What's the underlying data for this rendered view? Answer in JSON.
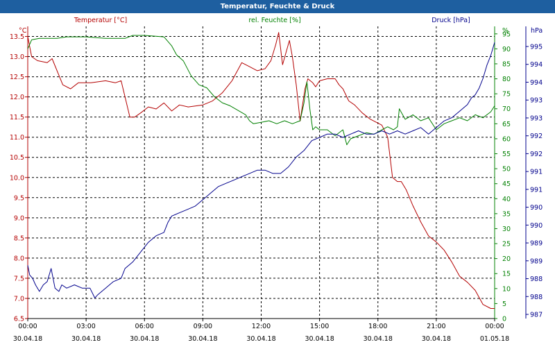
{
  "window": {
    "title": "Temperatur, Feuchte & Druck"
  },
  "chart_data": {
    "type": "line",
    "x_labels": [
      {
        "time": "00:00",
        "date": "30.04.18"
      },
      {
        "time": "03:00",
        "date": "30.04.18"
      },
      {
        "time": "06:00",
        "date": "30.04.18"
      },
      {
        "time": "09:00",
        "date": "30.04.18"
      },
      {
        "time": "12:00",
        "date": "30.04.18"
      },
      {
        "time": "15:00",
        "date": "30.04.18"
      },
      {
        "time": "18:00",
        "date": "30.04.18"
      },
      {
        "time": "21:00",
        "date": "30.04.18"
      },
      {
        "time": "00:00",
        "date": "01.05.18"
      }
    ],
    "xlim": [
      "30.04.18 00:00",
      "01.05.18 00:00"
    ],
    "grid": true,
    "axes": {
      "left": {
        "label": "Temperatur [°C]",
        "unit": "°C",
        "color": "#b40000",
        "ylim": [
          6.5,
          13.75
        ],
        "ticks": [
          "6.5",
          "7.0",
          "7.5",
          "8.0",
          "8.5",
          "9.0",
          "9.5",
          "10.0",
          "10.5",
          "11.0",
          "11.5",
          "12.0",
          "12.5",
          "13.0",
          "13.5"
        ]
      },
      "right1": {
        "label": "rel. Feuchte [%]",
        "unit": "%",
        "color": "#008000",
        "ylim": [
          0,
          97.5
        ],
        "ticks": [
          "0",
          "5",
          "10",
          "15",
          "20",
          "25",
          "30",
          "35",
          "40",
          "45",
          "50",
          "55",
          "60",
          "65",
          "70",
          "75",
          "80",
          "85",
          "90",
          "95"
        ]
      },
      "right2": {
        "label": "Druck [hPa]",
        "unit": "hPa",
        "color": "#00008c",
        "ticks": [
          "987",
          "988",
          "988",
          "989",
          "989",
          "990",
          "990",
          "991",
          "991",
          "992",
          "992",
          "993",
          "993",
          "994",
          "994",
          "995"
        ]
      }
    },
    "series": [
      {
        "name": "Temperatur [°C]",
        "axis": "left",
        "color": "#b40000",
        "x": [
          "30.04.18 00:00",
          "30.04.18 00:12",
          "30.04.18 00:30",
          "30.04.18 01:00",
          "30.04.18 01:15",
          "30.04.18 01:48",
          "30.04.18 02:12",
          "30.04.18 02:36",
          "30.04.18 02:55",
          "30.04.18 03:15",
          "30.04.18 04:00",
          "30.04.18 04:30",
          "30.04.18 04:48",
          "30.04.18 05:03",
          "30.04.18 05:15",
          "30.04.18 05:30",
          "30.04.18 05:48",
          "30.04.18 06:12",
          "30.04.18 06:36",
          "30.04.18 07:00",
          "30.04.18 07:24",
          "30.04.18 07:48",
          "30.04.18 08:15",
          "30.04.18 09:00",
          "30.04.18 09:30",
          "30.04.18 10:00",
          "30.04.18 10:30",
          "30.04.18 11:00",
          "30.04.18 11:24",
          "30.04.18 11:48",
          "30.04.18 12:12",
          "30.04.18 12:30",
          "30.04.18 12:45",
          "30.04.18 12:54",
          "30.04.18 13:06",
          "30.04.18 13:27",
          "30.04.18 13:36",
          "30.04.18 13:48",
          "30.04.18 14:00",
          "30.04.18 14:15",
          "30.04.18 14:24",
          "30.04.18 14:39",
          "30.04.18 14:48",
          "30.04.18 15:00",
          "30.04.18 15:24",
          "30.04.18 15:48",
          "30.04.18 16:00",
          "30.04.18 16:12",
          "30.04.18 16:30",
          "30.04.18 16:48",
          "30.04.18 17:12",
          "30.04.18 17:36",
          "30.04.18 18:00",
          "30.04.18 18:12",
          "30.04.18 18:30",
          "30.04.18 18:45",
          "30.04.18 19:00",
          "30.04.18 19:12",
          "30.04.18 19:27",
          "30.04.18 19:48",
          "30.04.18 20:12",
          "30.04.18 20:36",
          "30.04.18 21:00",
          "30.04.18 21:24",
          "30.04.18 21:48",
          "30.04.18 22:12",
          "30.04.18 22:36",
          "30.04.18 23:00",
          "30.04.18 23:24",
          "30.04.18 23:48",
          "01.05.18 00:00"
        ],
        "values": [
          13.5,
          13.0,
          12.9,
          12.85,
          12.95,
          12.3,
          12.2,
          12.35,
          12.35,
          12.35,
          12.4,
          12.35,
          12.4,
          11.9,
          11.5,
          11.5,
          11.6,
          11.75,
          11.7,
          11.85,
          11.65,
          11.8,
          11.75,
          11.8,
          11.9,
          12.1,
          12.4,
          12.85,
          12.75,
          12.65,
          12.7,
          12.9,
          13.3,
          13.6,
          12.8,
          13.4,
          13.0,
          12.3,
          11.4,
          12.2,
          12.45,
          12.35,
          12.25,
          12.4,
          12.45,
          12.45,
          12.3,
          12.2,
          11.9,
          11.8,
          11.6,
          11.45,
          11.35,
          11.3,
          11.0,
          10.0,
          9.9,
          9.9,
          9.7,
          9.3,
          8.9,
          8.55,
          8.4,
          8.2,
          7.9,
          7.55,
          7.4,
          7.2,
          6.85,
          6.75,
          6.75
        ]
      },
      {
        "name": "rel. Feuchte [%]",
        "axis": "right1",
        "color": "#008000",
        "x": [
          "30.04.18 00:00",
          "30.04.18 00:12",
          "30.04.18 00:36",
          "30.04.18 01:30",
          "30.04.18 02:00",
          "30.04.18 03:00",
          "30.04.18 04:00",
          "30.04.18 05:00",
          "30.04.18 05:24",
          "30.04.18 06:00",
          "30.04.18 07:00",
          "30.04.18 07:24",
          "30.04.18 07:39",
          "30.04.18 08:00",
          "30.04.18 08:24",
          "30.04.18 08:48",
          "30.04.18 09:12",
          "30.04.18 09:36",
          "30.04.18 10:00",
          "30.04.18 10:24",
          "30.04.18 10:48",
          "30.04.18 11:12",
          "30.04.18 11:24",
          "30.04.18 11:36",
          "30.04.18 12:00",
          "30.04.18 12:24",
          "30.04.18 12:48",
          "30.04.18 13:12",
          "30.04.18 13:36",
          "30.04.18 14:00",
          "30.04.18 14:12",
          "30.04.18 14:21",
          "30.04.18 14:30",
          "30.04.18 14:39",
          "30.04.18 14:48",
          "30.04.18 15:00",
          "30.04.18 15:24",
          "30.04.18 15:48",
          "30.04.18 16:12",
          "30.04.18 16:24",
          "30.04.18 16:36",
          "30.04.18 17:00",
          "30.04.18 17:24",
          "30.04.18 17:48",
          "30.04.18 18:12",
          "30.04.18 18:30",
          "30.04.18 18:48",
          "30.04.18 19:00",
          "30.04.18 19:06",
          "30.04.18 19:24",
          "30.04.18 19:48",
          "30.04.18 20:12",
          "30.04.18 20:36",
          "30.04.18 21:00",
          "30.04.18 21:24",
          "30.04.18 21:48",
          "30.04.18 22:12",
          "30.04.18 22:36",
          "30.04.18 23:00",
          "30.04.18 23:24",
          "30.04.18 23:48",
          "01.05.18 00:00"
        ],
        "values": [
          90,
          93,
          93.5,
          93.5,
          94,
          94,
          93.5,
          93.5,
          94.5,
          94.5,
          94,
          91,
          88,
          86,
          81,
          78,
          77,
          74,
          72,
          71,
          69.5,
          68,
          66,
          65,
          65.5,
          66,
          65,
          66,
          65,
          66,
          72,
          79,
          70,
          63,
          64,
          63,
          63,
          61,
          63,
          58,
          60,
          61,
          62,
          61.5,
          63,
          64,
          63,
          64,
          70,
          66.5,
          68,
          66,
          67,
          63,
          65,
          66,
          67,
          66,
          68,
          67,
          69,
          71
        ]
      },
      {
        "name": "Druck [hPa]",
        "axis": "right2",
        "color": "#00008c",
        "x": [
          "30.04.18 00:00",
          "30.04.18 00:06",
          "30.04.18 00:15",
          "30.04.18 00:24",
          "30.04.18 00:36",
          "30.04.18 00:48",
          "30.04.18 01:00",
          "30.04.18 01:12",
          "30.04.18 01:24",
          "30.04.18 01:36",
          "30.04.18 01:45",
          "30.04.18 02:00",
          "30.04.18 02:24",
          "30.04.18 02:48",
          "30.04.18 03:12",
          "30.04.18 03:27",
          "30.04.18 03:36",
          "30.04.18 04:00",
          "30.04.18 04:24",
          "30.04.18 04:48",
          "30.04.18 05:00",
          "30.04.18 05:24",
          "30.04.18 05:48",
          "30.04.18 06:12",
          "30.04.18 06:36",
          "30.04.18 07:00",
          "30.04.18 07:12",
          "30.04.18 07:24",
          "30.04.18 07:48",
          "30.04.18 08:12",
          "30.04.18 08:36",
          "30.04.18 09:00",
          "30.04.18 09:24",
          "30.04.18 09:48",
          "30.04.18 10:12",
          "30.04.18 10:36",
          "30.04.18 11:00",
          "30.04.18 11:24",
          "30.04.18 11:48",
          "30.04.18 12:12",
          "30.04.18 12:36",
          "30.04.18 13:00",
          "30.04.18 13:24",
          "30.04.18 13:48",
          "30.04.18 14:12",
          "30.04.18 14:36",
          "30.04.18 15:00",
          "30.04.18 15:24",
          "30.04.18 15:48",
          "30.04.18 16:12",
          "30.04.18 16:36",
          "30.04.18 17:00",
          "30.04.18 17:24",
          "30.04.18 17:48",
          "30.04.18 18:12",
          "30.04.18 18:36",
          "30.04.18 19:00",
          "30.04.18 19:24",
          "30.04.18 19:48",
          "30.04.18 20:12",
          "30.04.18 20:36",
          "30.04.18 21:00",
          "30.04.18 21:24",
          "30.04.18 21:48",
          "30.04.18 22:12",
          "30.04.18 22:36",
          "30.04.18 22:48",
          "30.04.18 23:00",
          "30.04.18 23:12",
          "30.04.18 23:24",
          "30.04.18 23:36",
          "30.04.18 23:48",
          "01.05.18 00:00"
        ],
        "values": [
          988.5,
          988.2,
          988.1,
          987.9,
          987.7,
          987.9,
          988.0,
          988.4,
          987.8,
          987.7,
          987.9,
          987.8,
          987.9,
          987.8,
          987.8,
          987.5,
          987.6,
          987.8,
          988.0,
          988.1,
          988.4,
          988.6,
          988.9,
          989.2,
          989.4,
          989.5,
          989.8,
          990.0,
          990.1,
          990.2,
          990.3,
          990.5,
          990.7,
          990.9,
          991.0,
          991.1,
          991.2,
          991.3,
          991.4,
          991.4,
          991.3,
          991.3,
          991.5,
          991.8,
          992.0,
          992.3,
          992.4,
          992.5,
          992.5,
          992.4,
          992.5,
          992.6,
          992.5,
          992.5,
          992.6,
          992.5,
          992.6,
          992.5,
          992.6,
          992.7,
          992.5,
          992.7,
          992.9,
          993.0,
          993.2,
          993.4,
          993.6,
          993.7,
          993.9,
          994.2,
          994.6,
          994.9,
          995.3
        ]
      }
    ]
  }
}
